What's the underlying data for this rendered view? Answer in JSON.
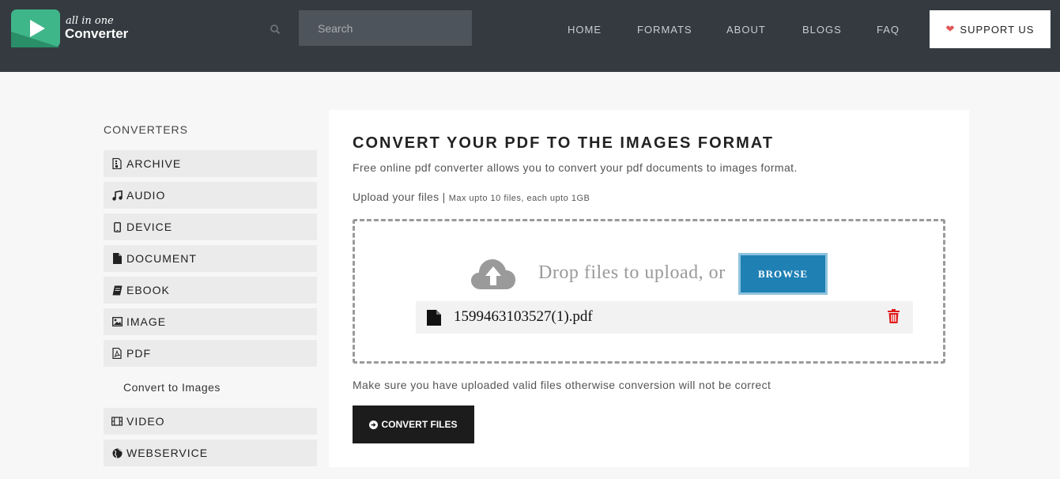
{
  "brand": {
    "small": "all in one",
    "big": "Converter"
  },
  "search": {
    "placeholder": "Search"
  },
  "nav": [
    {
      "label": "HOME"
    },
    {
      "label": "FORMATS"
    },
    {
      "label": "ABOUT"
    },
    {
      "label": "BLOGS"
    },
    {
      "label": "FAQ"
    }
  ],
  "support": {
    "label": "SUPPORT US",
    "icon": "heart-icon"
  },
  "sidebar": {
    "title": "CONVERTERS",
    "items": [
      {
        "label": "ARCHIVE",
        "icon": "file-archive-icon"
      },
      {
        "label": "AUDIO",
        "icon": "music-icon"
      },
      {
        "label": "DEVICE",
        "icon": "mobile-icon"
      },
      {
        "label": "DOCUMENT",
        "icon": "file-icon"
      },
      {
        "label": "EBOOK",
        "icon": "book-icon"
      },
      {
        "label": "IMAGE",
        "icon": "image-icon"
      },
      {
        "label": "PDF",
        "icon": "file-pdf-icon"
      },
      {
        "label": "VIDEO",
        "icon": "film-icon"
      },
      {
        "label": "WEBSERVICE",
        "icon": "globe-icon"
      }
    ],
    "sub_item": "Convert to Images"
  },
  "main": {
    "title": "CONVERT YOUR PDF TO THE IMAGES FORMAT",
    "description": "Free online pdf converter allows you to convert your pdf documents to images format.",
    "upload_label": "Upload your files",
    "upload_limits": "Max upto 10 files, each upto 1GB",
    "drop_text": "Drop files to upload, or",
    "browse_label": "BROWSE",
    "file_name": "1599463103527(1).pdf",
    "note": "Make sure you have uploaded valid files otherwise conversion will not be correct",
    "convert_label": "CONVERT FILES"
  },
  "colors": {
    "header_bg": "#343a40",
    "accent_green": "#3fb58a",
    "browse_blue": "#1f80b4",
    "trash_red": "#e01b1b"
  }
}
